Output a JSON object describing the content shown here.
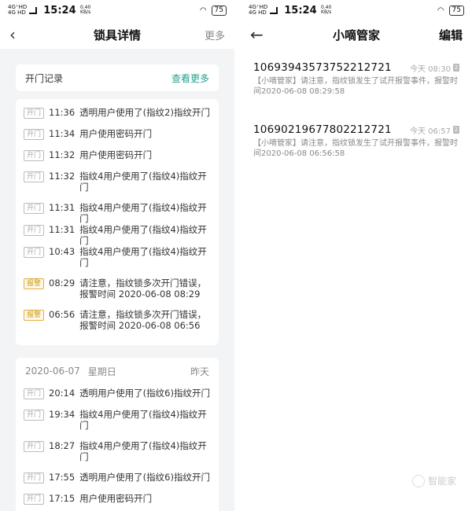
{
  "left": {
    "status": {
      "signal1": "4G⁺HD",
      "signal2": "4G HD",
      "time": "15:24",
      "net_speed": "0.40",
      "net_unit": "KB/s",
      "battery": "75"
    },
    "nav": {
      "back_icon": "back-chevron-icon",
      "title": "锁具详情",
      "action": "更多"
    },
    "today_card": {
      "title": "开门记录",
      "more": "查看更多",
      "records": [
        {
          "badge": "开门",
          "type": "open",
          "time": "11:36",
          "text": "透明用户使用了(指纹2)指纹开门"
        },
        {
          "badge": "开门",
          "type": "open",
          "time": "11:34",
          "text": "用户使用密码开门"
        },
        {
          "badge": "开门",
          "type": "open",
          "time": "11:32",
          "text": "用户使用密码开门"
        },
        {
          "badge": "开门",
          "type": "open",
          "time": "11:32",
          "text": "指纹4用户使用了(指纹4)指纹开门"
        },
        {
          "badge": "开门",
          "type": "open",
          "time": "11:31",
          "text": "指纹4用户使用了(指纹4)指纹开门"
        },
        {
          "badge": "开门",
          "type": "open",
          "time": "11:31",
          "text": "指纹4用户使用了(指纹4)指纹开门"
        },
        {
          "badge": "开门",
          "type": "open",
          "time": "10:43",
          "text": "指纹4用户使用了(指纹4)指纹开门"
        },
        {
          "badge": "报警",
          "type": "alarm",
          "time": "08:29",
          "text": "请注意，指纹锁多次开门错误，报警时间 2020-06-08 08:29"
        },
        {
          "badge": "报警",
          "type": "alarm",
          "time": "06:56",
          "text": "请注意，指纹锁多次开门错误，报警时间 2020-06-08 06:56"
        }
      ]
    },
    "prev_card": {
      "date": "2020-06-07",
      "weekday": "星期日",
      "label": "昨天",
      "records": [
        {
          "badge": "开门",
          "type": "open",
          "time": "20:14",
          "text": "透明用户使用了(指纹6)指纹开门"
        },
        {
          "badge": "开门",
          "type": "open",
          "time": "19:34",
          "text": "指纹4用户使用了(指纹4)指纹开门"
        },
        {
          "badge": "开门",
          "type": "open",
          "time": "18:27",
          "text": "指纹4用户使用了(指纹4)指纹开门"
        },
        {
          "badge": "开门",
          "type": "open",
          "time": "17:55",
          "text": "透明用户使用了(指纹6)指纹开门"
        },
        {
          "badge": "开门",
          "type": "open",
          "time": "17:15",
          "text": "用户使用密码开门"
        }
      ]
    }
  },
  "right": {
    "status": {
      "signal1": "4G⁺HD",
      "signal2": "4G HD",
      "time": "15:24",
      "net_speed": "0.40",
      "net_unit": "KB/s",
      "battery": "75"
    },
    "nav": {
      "back_icon": "back-arrow-icon",
      "title": "小嘀管家",
      "action": "编辑"
    },
    "messages": [
      {
        "number": "1069394357375221272​1",
        "time": "今天 08:30",
        "sim": "2",
        "body": "【小嘀管家】请注意，指纹锁发生了试开报警事件，报警时间2020-06-08 08:29:58"
      },
      {
        "number": "10690219677802212721",
        "time": "今天 06:57",
        "sim": "2",
        "body": "【小嘀管家】请注意，指纹锁发生了试开报警事件，报警时间2020-06-08 06:56:58"
      }
    ]
  },
  "watermark": "智能家"
}
